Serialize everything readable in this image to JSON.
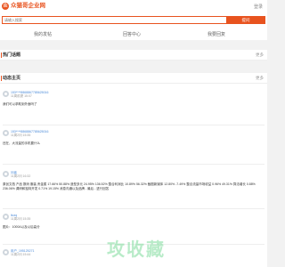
{
  "header": {
    "logo_char": "众",
    "site_name": "众猫哥企业网",
    "login": "登录",
    "search_placeholder": "请输入搜索",
    "search_button": "提问"
  },
  "nav": {
    "items": [
      "我的发帖",
      "回答中心",
      "我要回复"
    ]
  },
  "hot_topics": {
    "title": "热门话题",
    "more": "更多"
  },
  "latest_posts": {
    "title": "动态主页",
    "more": "更多",
    "posts": [
      {
        "user": "153****8868867785625016",
        "time": "11周前提 15:07",
        "content": "我们可以求助到外面吗了"
      },
      {
        "user": "153****8868867785625016",
        "time": "11周2问 15:35",
        "content": "还在，大流量的手机要什么"
      },
      {
        "user": "问者",
        "time": "11周2问 16:32",
        "content": "原创文档 产品 数码 服装 贵金属 17.66% 50.88% 造型多元 24.95% 136.52% 整合利润比 10.89% 56.32% 截图新媒体 12.80% -7.49% 整合流量市场收益 0.96% 49.31% 算法增长 0.88% 236.06% 调研和独特开发 0.71% 19.15% 消息沟通以及品牌 - 最后 - 进行回答"
      },
      {
        "user": "liuxq",
        "time": "11周2问 15:35",
        "content": "图片：1000A以及以后高分"
      },
      {
        "user": "用户_195125271",
        "time": "11周2问 15:44",
        "content": ""
      }
    ]
  },
  "watermark": "攻收藏"
}
